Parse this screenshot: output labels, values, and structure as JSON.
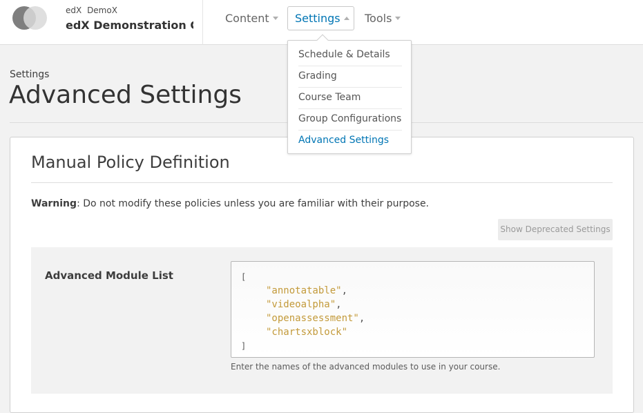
{
  "header": {
    "org": "edX",
    "number": "DemoX",
    "course_title": "edX Demonstration C...",
    "nav": {
      "content": "Content",
      "settings": "Settings",
      "tools": "Tools"
    }
  },
  "settings_menu": {
    "items": [
      {
        "label": "Schedule & Details"
      },
      {
        "label": "Grading"
      },
      {
        "label": "Course Team"
      },
      {
        "label": "Group Configurations"
      },
      {
        "label": "Advanced Settings",
        "active": true
      }
    ]
  },
  "page": {
    "subtitle": "Settings",
    "title": "Advanced Settings"
  },
  "policy": {
    "section_title": "Manual Policy Definition",
    "warning_label": "Warning",
    "warning_text": ": Do not modify these policies unless you are familiar with their purpose.",
    "deprecated_button": "Show Deprecated Settings",
    "field": {
      "label": "Advanced Module List",
      "open_bracket": "[",
      "close_bracket": "]",
      "values": [
        {
          "text": "\"annotatable\"",
          "sep": ","
        },
        {
          "text": "\"videoalpha\"",
          "sep": ","
        },
        {
          "text": "\"openassessment\"",
          "sep": ","
        },
        {
          "text": "\"chartsxblock\"",
          "sep": ""
        }
      ],
      "help": "Enter the names of the advanced modules to use in your course."
    }
  },
  "colors": {
    "link_blue": "#0075b4",
    "string_gold": "#c39a3a"
  }
}
